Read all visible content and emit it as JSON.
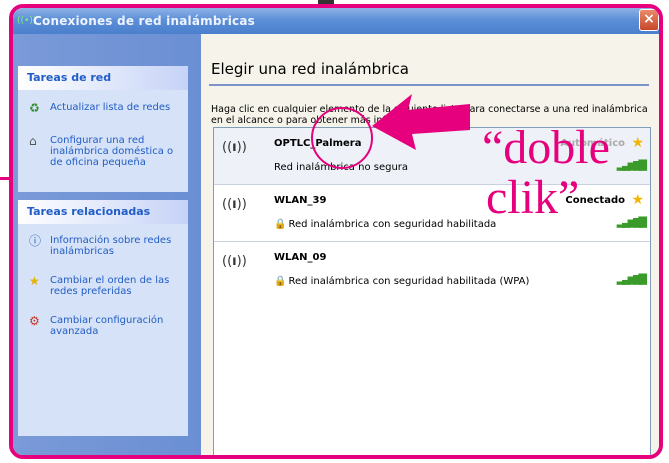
{
  "window": {
    "title": "Conexiones de red inalámbricas",
    "close_glyph": "×"
  },
  "sidebar": {
    "tasks_header": "Tareas de red",
    "tasks": [
      {
        "icon": "refresh-icon",
        "label": "Actualizar lista de redes"
      },
      {
        "icon": "home-network-icon",
        "label": "Configurar una red inalámbrica doméstica o de oficina pequeña"
      }
    ],
    "related_header": "Tareas relacionadas",
    "related": [
      {
        "icon": "info-icon",
        "label": "Información sobre redes inalámbricas"
      },
      {
        "icon": "star-icon",
        "label": "Cambiar el orden de las redes preferidas"
      },
      {
        "icon": "settings-icon",
        "label": "Cambiar configuración avanzada"
      }
    ]
  },
  "main": {
    "title": "Elegir una red inalámbrica",
    "instruction": "Haga clic en cualquier elemento de la siguiente lista para conectarse a una red inalámbrica en el alcance o para obtener más información.",
    "networks": [
      {
        "name": "OPTLC_Palmera",
        "security": "Red inalámbrica no segura",
        "status": "Automático",
        "secured": false,
        "selected": true
      },
      {
        "name": "WLAN_39",
        "security": "Red inalámbrica con seguridad habilitada",
        "status": "Conectado",
        "secured": true,
        "selected": false
      },
      {
        "name": "WLAN_09",
        "security": "Red inalámbrica con seguridad habilitada (WPA)",
        "status": "",
        "secured": true,
        "selected": false
      }
    ]
  },
  "annotation": {
    "line1": "“doble",
    "line2": "clik”",
    "color": "#e6007e"
  }
}
